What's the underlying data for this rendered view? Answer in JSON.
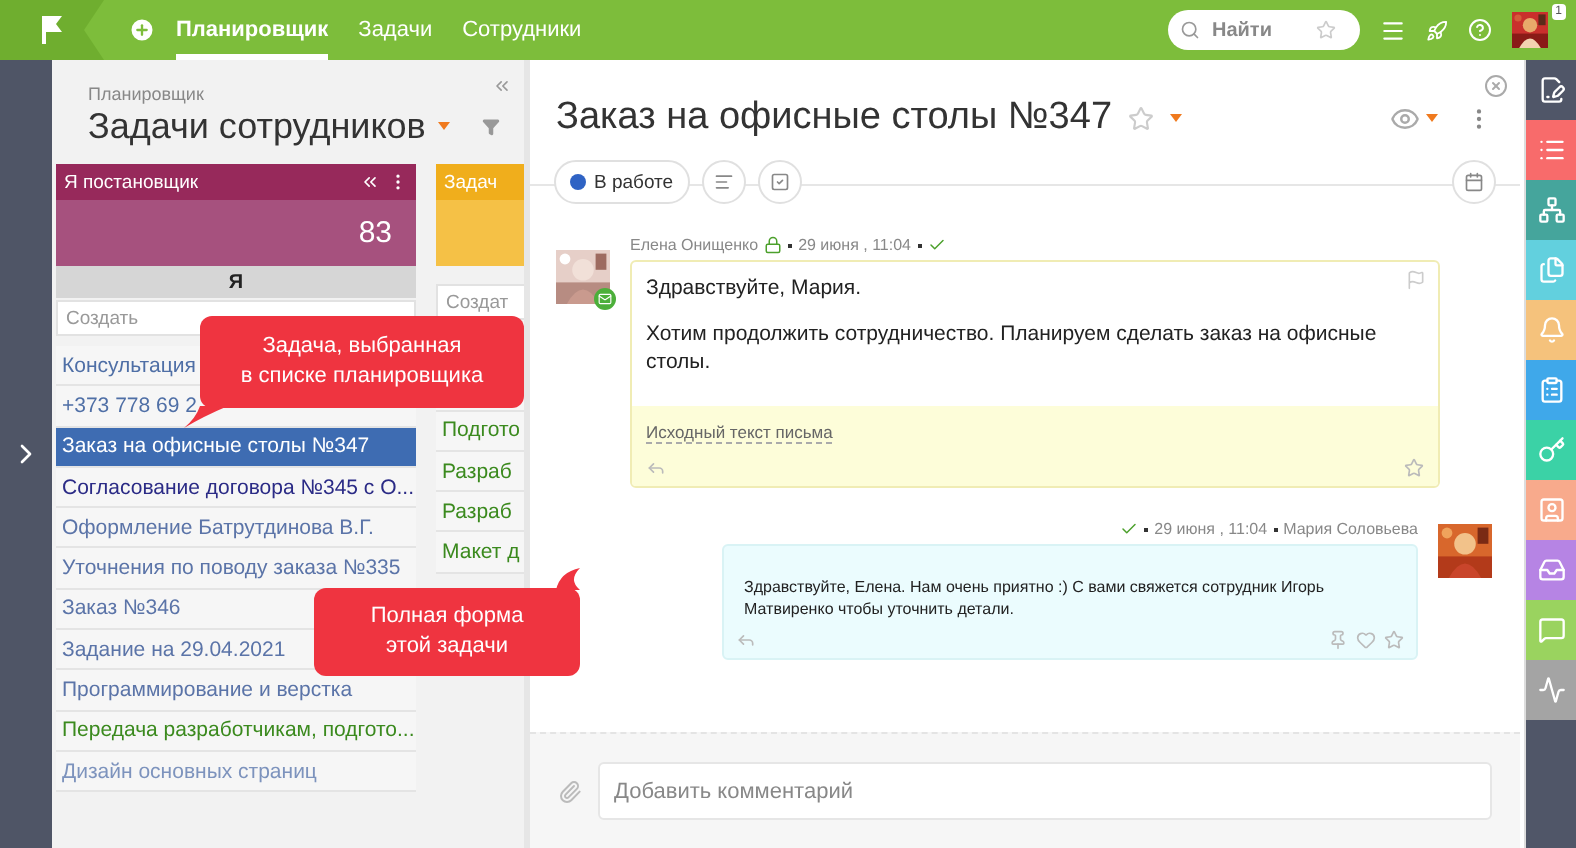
{
  "topbar": {
    "nav": [
      {
        "label": "Планировщик",
        "selected": true
      },
      {
        "label": "Задачи",
        "selected": false
      },
      {
        "label": "Сотрудники",
        "selected": false
      }
    ],
    "search": {
      "placeholder": "Найти"
    },
    "notification_count": "1"
  },
  "planner": {
    "breadcrumb": "Планировщик",
    "title": "Задачи сотрудников",
    "columns": [
      {
        "title": "Я постановщик",
        "color": "#97295b",
        "count": "83",
        "group": "Я",
        "create_placeholder": "Создать",
        "items": [
          {
            "label": "Консультация",
            "color": "#4f6fa6",
            "selected": false
          },
          {
            "label": "+373 778 69 2",
            "color": "#4f6fa6",
            "selected": false
          },
          {
            "label": "Заказ на офисные столы №347",
            "selected": true
          },
          {
            "label": "Согласование договора №345 с О...",
            "color": "#2b2b86",
            "selected": false
          },
          {
            "label": "Оформление Батрутдинова В.Г.",
            "color": "#5b74a8",
            "selected": false
          },
          {
            "label": "Уточнения по поводу заказа №335",
            "color": "#5b74a8",
            "selected": false
          },
          {
            "label": "Заказ №346",
            "color": "#5b74a8",
            "selected": false
          },
          {
            "label": "Задание на 29.04.2021",
            "color": "#5b74a8",
            "selected": false
          },
          {
            "label": "Программирование и верстка",
            "color": "#5b74a8",
            "selected": false
          },
          {
            "label": "Передача разработчикам, подгото...",
            "color": "#3b8a1e",
            "selected": false
          },
          {
            "label": "Дизайн основных страниц",
            "color": "#7d93bd",
            "selected": false
          }
        ]
      },
      {
        "title": "Задач",
        "color": "#f0ae1c",
        "create_placeholder": "Создат",
        "items": [
          {
            "label": "Подгото",
            "color": "#3b8a1e",
            "selected": false
          },
          {
            "label": "Разраб",
            "color": "#3b8a1e",
            "selected": false
          },
          {
            "label": "Разраб",
            "color": "#3b8a1e",
            "selected": false
          },
          {
            "label": "Макет д",
            "color": "#3b8a1e",
            "selected": false
          }
        ]
      }
    ]
  },
  "callouts": [
    {
      "text": "Задача, выбранная\nв списке планировщика"
    },
    {
      "text": "Полная форма\nэтой задачи"
    }
  ],
  "task": {
    "title": "Заказ на офисные столы №347",
    "status": {
      "label": "В работе"
    },
    "messages": [
      {
        "kind": "incoming",
        "author": "Елена Онищенко",
        "date": "29 июня , 11:04",
        "read": true,
        "paragraphs": [
          "Здравствуйте, Мария.",
          "Хотим продолжить сотрудничество. Планируем сделать заказ на офисные столы."
        ],
        "source_link": "Исходный текст письма"
      },
      {
        "kind": "outgoing",
        "author": "Мария Соловьева",
        "date": "29 июня , 11:04",
        "read": true,
        "paragraphs": [
          "Здравствуйте, Елена. Нам очень приятно :) С вами свяжется сотрудник Игорь Матвиренко чтобы уточнить детали."
        ]
      }
    ],
    "comment_placeholder": "Добавить комментарий"
  },
  "side_tools": [
    {
      "color": "#505668"
    },
    {
      "color": "#f86b6b"
    },
    {
      "color": "#45a59c"
    },
    {
      "color": "#62d0de"
    },
    {
      "color": "#f5c27c"
    },
    {
      "color": "#3fa8ea"
    },
    {
      "color": "#3bd2a6"
    },
    {
      "color": "#f8aa8c"
    },
    {
      "color": "#b684e4"
    },
    {
      "color": "#9ad35f"
    },
    {
      "color": "#a4a4a4"
    }
  ]
}
